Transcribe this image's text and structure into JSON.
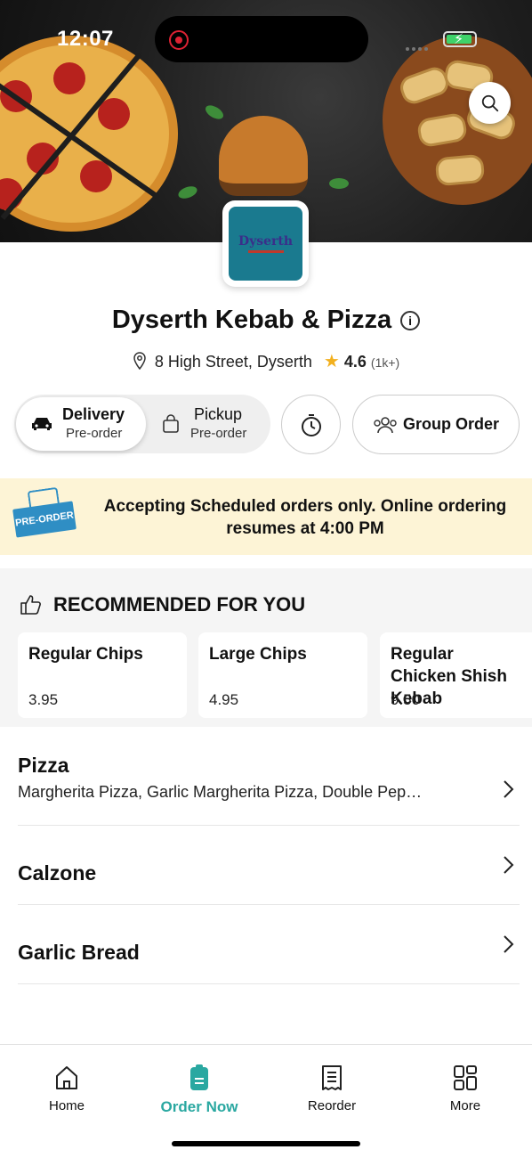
{
  "status_bar": {
    "time": "12:07"
  },
  "restaurant": {
    "name": "Dyserth Kebab & Pizza",
    "logo_text": "Dyserth",
    "address": "8 High Street, Dyserth",
    "rating": "4.6",
    "rating_count": "(1k+)"
  },
  "order_mode": {
    "delivery": {
      "label": "Delivery",
      "sub": "Pre-order",
      "selected": true
    },
    "pickup": {
      "label": "Pickup",
      "sub": "Pre-order",
      "selected": false
    },
    "group_order_label": "Group Order"
  },
  "banner": {
    "badge": "PRE-ORDER",
    "message": "Accepting Scheduled orders only. Online ordering resumes at 4:00 PM",
    "color": "#fdf4d6"
  },
  "recommended": {
    "title": "RECOMMENDED FOR YOU",
    "items": [
      {
        "name": "Regular Chips",
        "price": "3.95"
      },
      {
        "name": "Large Chips",
        "price": "4.95"
      },
      {
        "name": "Regular Chicken Shish Kebab",
        "price": "9.50"
      }
    ]
  },
  "categories": [
    {
      "name": "Pizza",
      "description": "Margherita Pizza, Garlic Margherita Pizza, Double Pep…"
    },
    {
      "name": "Calzone",
      "description": ""
    },
    {
      "name": "Garlic Bread",
      "description": ""
    }
  ],
  "tabbar": {
    "items": [
      {
        "label": "Home",
        "icon": "home-icon"
      },
      {
        "label": "Order Now",
        "icon": "order-icon",
        "active": true
      },
      {
        "label": "Reorder",
        "icon": "receipt-icon"
      },
      {
        "label": "More",
        "icon": "grid-icon"
      }
    ],
    "accent_color": "#2aa8a1"
  }
}
